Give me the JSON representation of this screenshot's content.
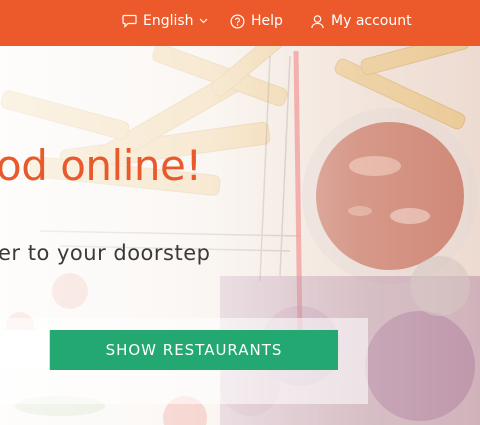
{
  "nav": {
    "language": {
      "label": "English",
      "icon": "speech-bubble-icon"
    },
    "help": {
      "label": "Help",
      "icon": "question-circle-icon"
    },
    "account": {
      "label": "My account",
      "icon": "user-icon"
    }
  },
  "hero": {
    "headline": "od online!",
    "subline": "er to your doorstep"
  },
  "search": {
    "input_value": "",
    "button_label": "SHOW RESTAURANTS"
  },
  "colors": {
    "brand": "#ec5a2b",
    "headline": "#e85a2b",
    "cta": "#22a870"
  }
}
